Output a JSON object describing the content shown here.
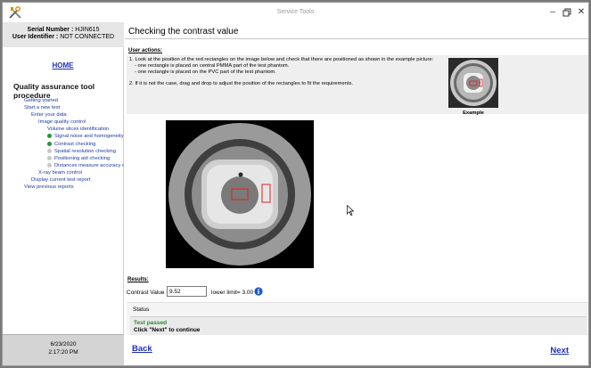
{
  "window": {
    "title": "Service Tools"
  },
  "sidebar": {
    "serial_label": "Serial Number :",
    "serial_value": "HJIN615",
    "user_label": "User Identifier :",
    "user_value": "NOT CONNECTED",
    "home": "HOME",
    "procedure_title": "Quality assurance tool procedure",
    "items": [
      {
        "label": "Getting started",
        "indent": 0,
        "dot": ""
      },
      {
        "label": "Start a new test",
        "indent": 0,
        "dot": ""
      },
      {
        "label": "Enter your data",
        "indent": 1,
        "dot": ""
      },
      {
        "label": "Image quality control",
        "indent": 2,
        "dot": ""
      },
      {
        "label": "Volume slices identification",
        "indent": 3,
        "dot": ""
      },
      {
        "label": "Signal noise and homogeneity c",
        "indent": 3,
        "dot": "green"
      },
      {
        "label": "Contrast checking",
        "indent": 3,
        "dot": "green"
      },
      {
        "label": "Spatial resolution checking",
        "indent": 3,
        "dot": "gray"
      },
      {
        "label": "Positioning aid checking",
        "indent": 3,
        "dot": "gray"
      },
      {
        "label": "Distances measure accuracy ch",
        "indent": 3,
        "dot": "gray"
      },
      {
        "label": "X-ray beam control",
        "indent": 2,
        "dot": ""
      },
      {
        "label": "Display current test report",
        "indent": 1,
        "dot": ""
      },
      {
        "label": "View previous reports",
        "indent": 0,
        "dot": ""
      }
    ],
    "date": "6/23/2020",
    "time": "2:17:20 PM"
  },
  "main": {
    "title": "Checking the contrast value",
    "user_actions_label": "User actions:",
    "instr_1": "1. Look at the position of the red rectangles on the image below and check that there are positioned as shown in the example picture:",
    "instr_1a": "- one rectangle is placed on central PMMA part of the test phantom.",
    "instr_1b": "- one rectangle is placed on the PVC part of the test phantom.",
    "instr_2": "2. If it is not the case, drag and drop to adjust the position of the rectangles to fit the requirements.",
    "example_label": "Example",
    "results_label": "Results:",
    "contrast_label": "Contrast Value",
    "contrast_value": "9.52",
    "lower_limit": "lower limit= 3.00",
    "status_title": "Status",
    "status_result": "Test passed",
    "status_hint": "Click \"Next\" to continue",
    "back": "Back",
    "next": "Next"
  },
  "colors": {
    "link": "#1c32b7",
    "pass": "#2a8a2a",
    "dot_done": "#1e9a2e",
    "dot_todo": "#c8c8c8",
    "roi": "#e02020"
  }
}
